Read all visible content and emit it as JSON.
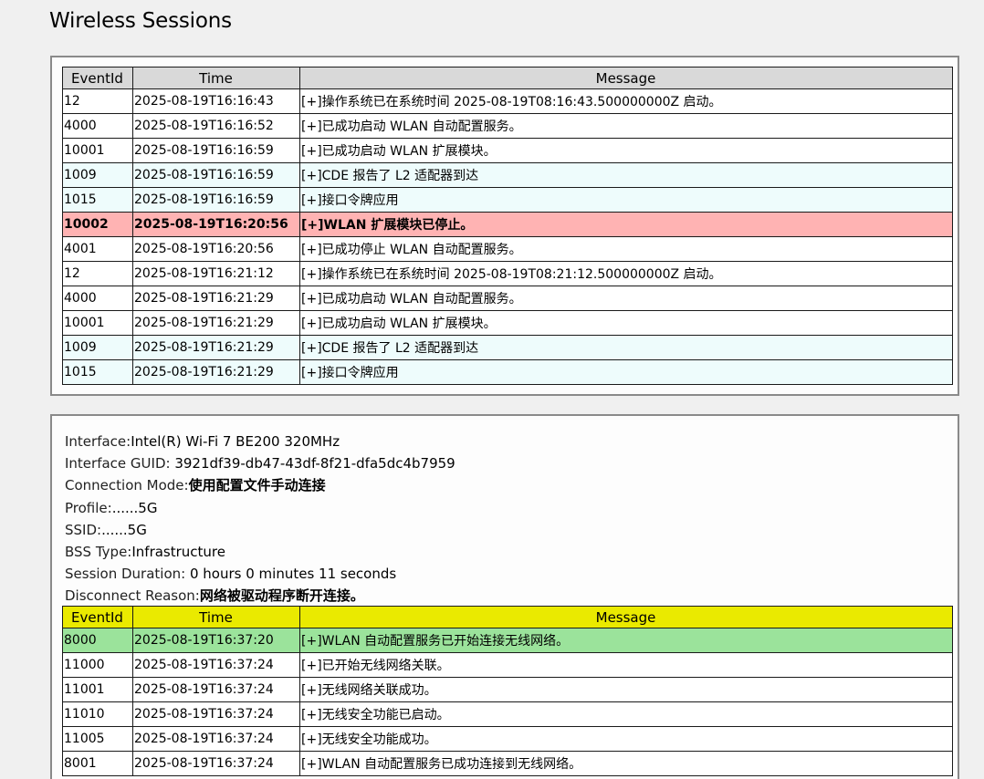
{
  "page_title": "Wireless Sessions",
  "columns": {
    "event_id": "EventId",
    "time": "Time",
    "message": "Message"
  },
  "colors": {
    "header_gray": "#d9d9d9",
    "header_yellow": "#eaea00",
    "row_info": "#eefcfc",
    "row_error": "#ffb3b3",
    "row_success": "#9be39b"
  },
  "session1": {
    "events": [
      {
        "id": "12",
        "time": "2025-08-19T16:16:43",
        "message": "[+]操作系统已在系统时间 2025-08-19T08:16:43.500000000Z 启动。",
        "type": "normal"
      },
      {
        "id": "4000",
        "time": "2025-08-19T16:16:52",
        "message": "[+]已成功启动 WLAN 自动配置服务。",
        "type": "normal"
      },
      {
        "id": "10001",
        "time": "2025-08-19T16:16:59",
        "message": "[+]已成功启动 WLAN 扩展模块。",
        "type": "normal"
      },
      {
        "id": "1009",
        "time": "2025-08-19T16:16:59",
        "message": "[+]CDE 报告了 L2 适配器到达",
        "type": "info"
      },
      {
        "id": "1015",
        "time": "2025-08-19T16:16:59",
        "message": "[+]接口令牌应用",
        "type": "info"
      },
      {
        "id": "10002",
        "time": "2025-08-19T16:20:56",
        "message": "[+]WLAN 扩展模块已停止。",
        "type": "error"
      },
      {
        "id": "4001",
        "time": "2025-08-19T16:20:56",
        "message": "[+]已成功停止 WLAN 自动配置服务。",
        "type": "normal"
      },
      {
        "id": "12",
        "time": "2025-08-19T16:21:12",
        "message": "[+]操作系统已在系统时间 2025-08-19T08:21:12.500000000Z 启动。",
        "type": "normal"
      },
      {
        "id": "4000",
        "time": "2025-08-19T16:21:29",
        "message": "[+]已成功启动 WLAN 自动配置服务。",
        "type": "normal"
      },
      {
        "id": "10001",
        "time": "2025-08-19T16:21:29",
        "message": "[+]已成功启动 WLAN 扩展模块。",
        "type": "normal"
      },
      {
        "id": "1009",
        "time": "2025-08-19T16:21:29",
        "message": "[+]CDE 报告了 L2 适配器到达",
        "type": "info"
      },
      {
        "id": "1015",
        "time": "2025-08-19T16:21:29",
        "message": "[+]接口令牌应用",
        "type": "info"
      }
    ]
  },
  "session2": {
    "info": {
      "interface_label": "Interface:",
      "interface_value": "Intel(R) Wi-Fi 7 BE200 320MHz",
      "guid_label": "Interface GUID: ",
      "guid_value": "3921df39-db47-43df-8f21-dfa5dc4b7959",
      "mode_label": "Connection Mode:",
      "mode_value": "使用配置文件手动连接",
      "profile_label": "Profile:",
      "profile_value": "......5G",
      "ssid_label": "SSID:",
      "ssid_value": "......5G",
      "bss_label": "BSS Type:",
      "bss_value": "Infrastructure",
      "duration_label": "Session Duration: ",
      "duration_value": "0 hours 0 minutes 11 seconds",
      "reason_label": "Disconnect Reason:",
      "reason_value": "网络被驱动程序断开连接。"
    },
    "events": [
      {
        "id": "8000",
        "time": "2025-08-19T16:37:20",
        "message": "[+]WLAN 自动配置服务已开始连接无线网络。",
        "type": "success"
      },
      {
        "id": "11000",
        "time": "2025-08-19T16:37:24",
        "message": "[+]已开始无线网络关联。",
        "type": "normal"
      },
      {
        "id": "11001",
        "time": "2025-08-19T16:37:24",
        "message": "[+]无线网络关联成功。",
        "type": "normal"
      },
      {
        "id": "11010",
        "time": "2025-08-19T16:37:24",
        "message": "[+]无线安全功能已启动。",
        "type": "normal"
      },
      {
        "id": "11005",
        "time": "2025-08-19T16:37:24",
        "message": "[+]无线安全功能成功。",
        "type": "normal"
      },
      {
        "id": "8001",
        "time": "2025-08-19T16:37:24",
        "message": "[+]WLAN 自动配置服务已成功连接到无线网络。",
        "type": "normal"
      }
    ]
  }
}
